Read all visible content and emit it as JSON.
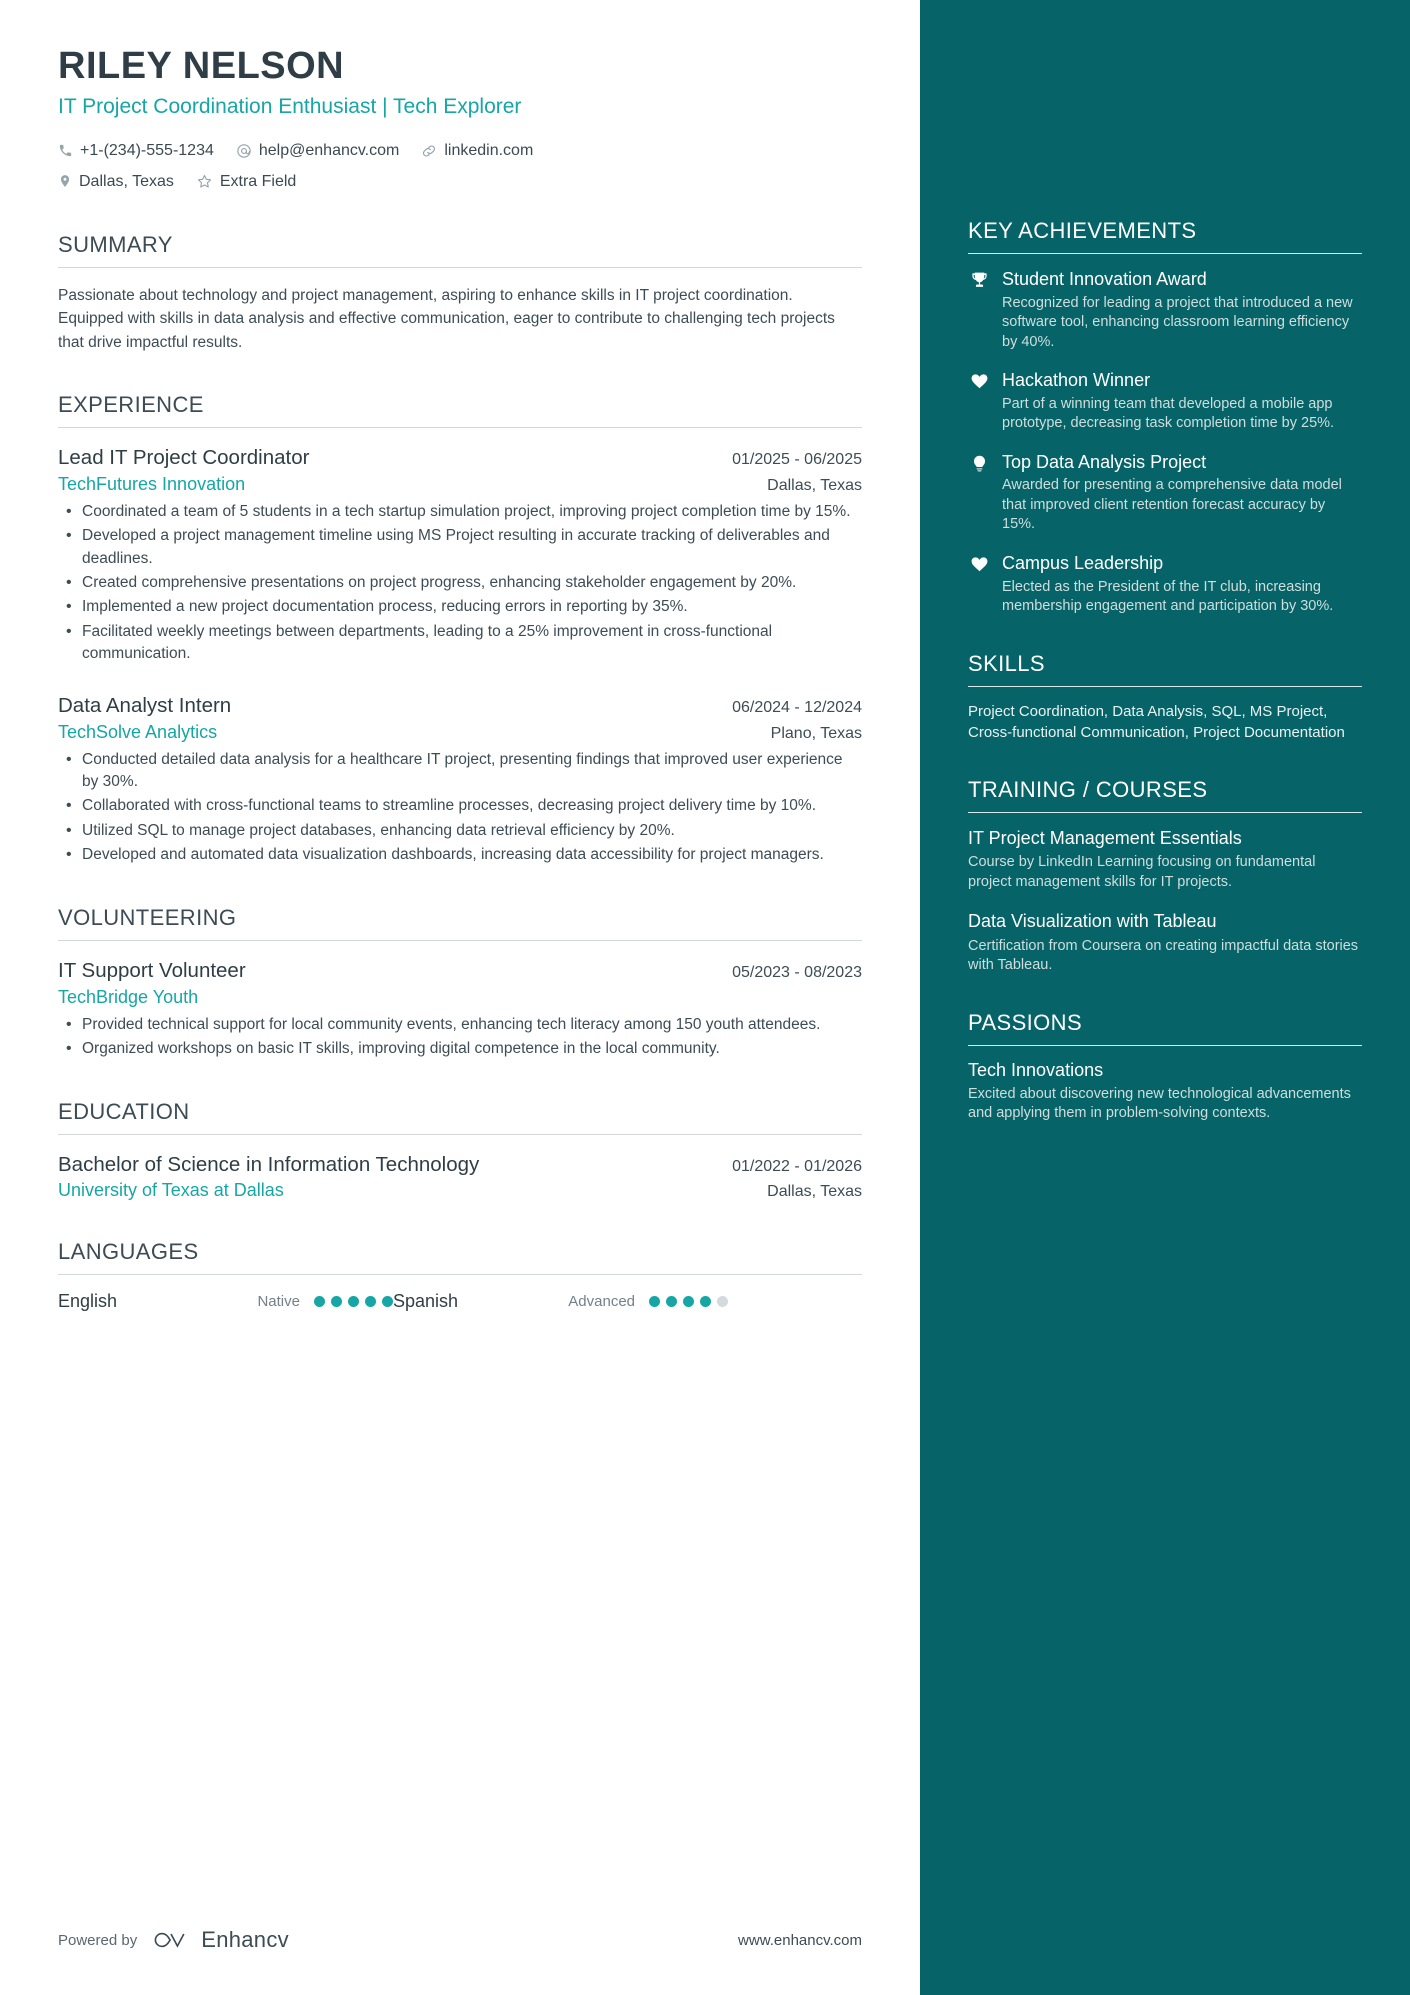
{
  "header": {
    "name": "RILEY NELSON",
    "headline": "IT Project Coordination Enthusiast | Tech Explorer",
    "contacts_row1": [
      {
        "icon": "phone-icon",
        "text": "+1-(234)-555-1234"
      },
      {
        "icon": "email-icon",
        "text": "help@enhancv.com"
      },
      {
        "icon": "link-icon",
        "text": "linkedin.com"
      }
    ],
    "contacts_row2": [
      {
        "icon": "location-pin-icon",
        "text": "Dallas, Texas"
      },
      {
        "icon": "star-icon",
        "text": "Extra Field"
      }
    ]
  },
  "summary": {
    "title": "SUMMARY",
    "text": "Passionate about technology and project management, aspiring to enhance skills in IT project coordination. Equipped with skills in data analysis and effective communication, eager to contribute to challenging tech projects that drive impactful results."
  },
  "experience": {
    "title": "EXPERIENCE",
    "entries": [
      {
        "role": "Lead IT Project Coordinator",
        "date": "01/2025 - 06/2025",
        "company": "TechFutures Innovation",
        "location": "Dallas, Texas",
        "bullets": [
          "Coordinated a team of 5 students in a tech startup simulation project, improving project completion time by 15%.",
          "Developed a project management timeline using MS Project resulting in accurate tracking of deliverables and deadlines.",
          "Created comprehensive presentations on project progress, enhancing stakeholder engagement by 20%.",
          "Implemented a new project documentation process, reducing errors in reporting by 35%.",
          "Facilitated weekly meetings between departments, leading to a 25% improvement in cross-functional communication."
        ]
      },
      {
        "role": "Data Analyst Intern",
        "date": "06/2024 - 12/2024",
        "company": "TechSolve Analytics",
        "location": "Plano, Texas",
        "bullets": [
          "Conducted detailed data analysis for a healthcare IT project, presenting findings that improved user experience by 30%.",
          "Collaborated with cross-functional teams to streamline processes, decreasing project delivery time by 10%.",
          "Utilized SQL to manage project databases, enhancing data retrieval efficiency by 20%.",
          "Developed and automated data visualization dashboards, increasing data accessibility for project managers."
        ]
      }
    ]
  },
  "volunteering": {
    "title": "VOLUNTEERING",
    "entries": [
      {
        "role": "IT Support Volunteer",
        "date": "05/2023 - 08/2023",
        "company": "TechBridge Youth",
        "location": "",
        "bullets": [
          "Provided technical support for local community events, enhancing tech literacy among 150 youth attendees.",
          "Organized workshops on basic IT skills, improving digital competence in the local community."
        ]
      }
    ]
  },
  "education": {
    "title": "EDUCATION",
    "entries": [
      {
        "degree": "Bachelor of Science in Information Technology",
        "date": "01/2022 - 01/2026",
        "school": "University of Texas at Dallas",
        "location": "Dallas, Texas"
      }
    ]
  },
  "languages": {
    "title": "LANGUAGES",
    "items": [
      {
        "name": "English",
        "level": "Native",
        "filled": 5,
        "total": 5
      },
      {
        "name": "Spanish",
        "level": "Advanced",
        "filled": 4,
        "total": 5
      }
    ]
  },
  "footer": {
    "powered_by": "Powered by",
    "brand": "Enhancv",
    "website": "www.enhancv.com"
  },
  "sidebar": {
    "achievements": {
      "title": "KEY ACHIEVEMENTS",
      "items": [
        {
          "icon": "trophy-icon",
          "title": "Student Innovation Award",
          "desc": "Recognized for leading a project that introduced a new software tool, enhancing classroom learning efficiency by 40%."
        },
        {
          "icon": "heart-icon",
          "title": "Hackathon Winner",
          "desc": "Part of a winning team that developed a mobile app prototype, decreasing task completion time by 25%."
        },
        {
          "icon": "lightbulb-icon",
          "title": "Top Data Analysis Project",
          "desc": "Awarded for presenting a comprehensive data model that improved client retention forecast accuracy by 15%."
        },
        {
          "icon": "heart-icon",
          "title": "Campus Leadership",
          "desc": "Elected as the President of the IT club, increasing membership engagement and participation by 30%."
        }
      ]
    },
    "skills": {
      "title": "SKILLS",
      "text": "Project Coordination, Data Analysis, SQL, MS Project, Cross-functional Communication, Project Documentation"
    },
    "training": {
      "title": "TRAINING / COURSES",
      "items": [
        {
          "title": "IT Project Management Essentials",
          "desc": "Course by LinkedIn Learning focusing on fundamental project management skills for IT projects."
        },
        {
          "title": "Data Visualization with Tableau",
          "desc": "Certification from Coursera on creating impactful data stories with Tableau."
        }
      ]
    },
    "passions": {
      "title": "PASSIONS",
      "items": [
        {
          "title": "Tech Innovations",
          "desc": "Excited about discovering new technological advancements and applying them in problem-solving contexts."
        }
      ]
    }
  },
  "colors": {
    "sidebar_bg": "#066367",
    "accent": "#16a6a6",
    "heading": "#3c4b54",
    "body": "#3d4c55"
  }
}
